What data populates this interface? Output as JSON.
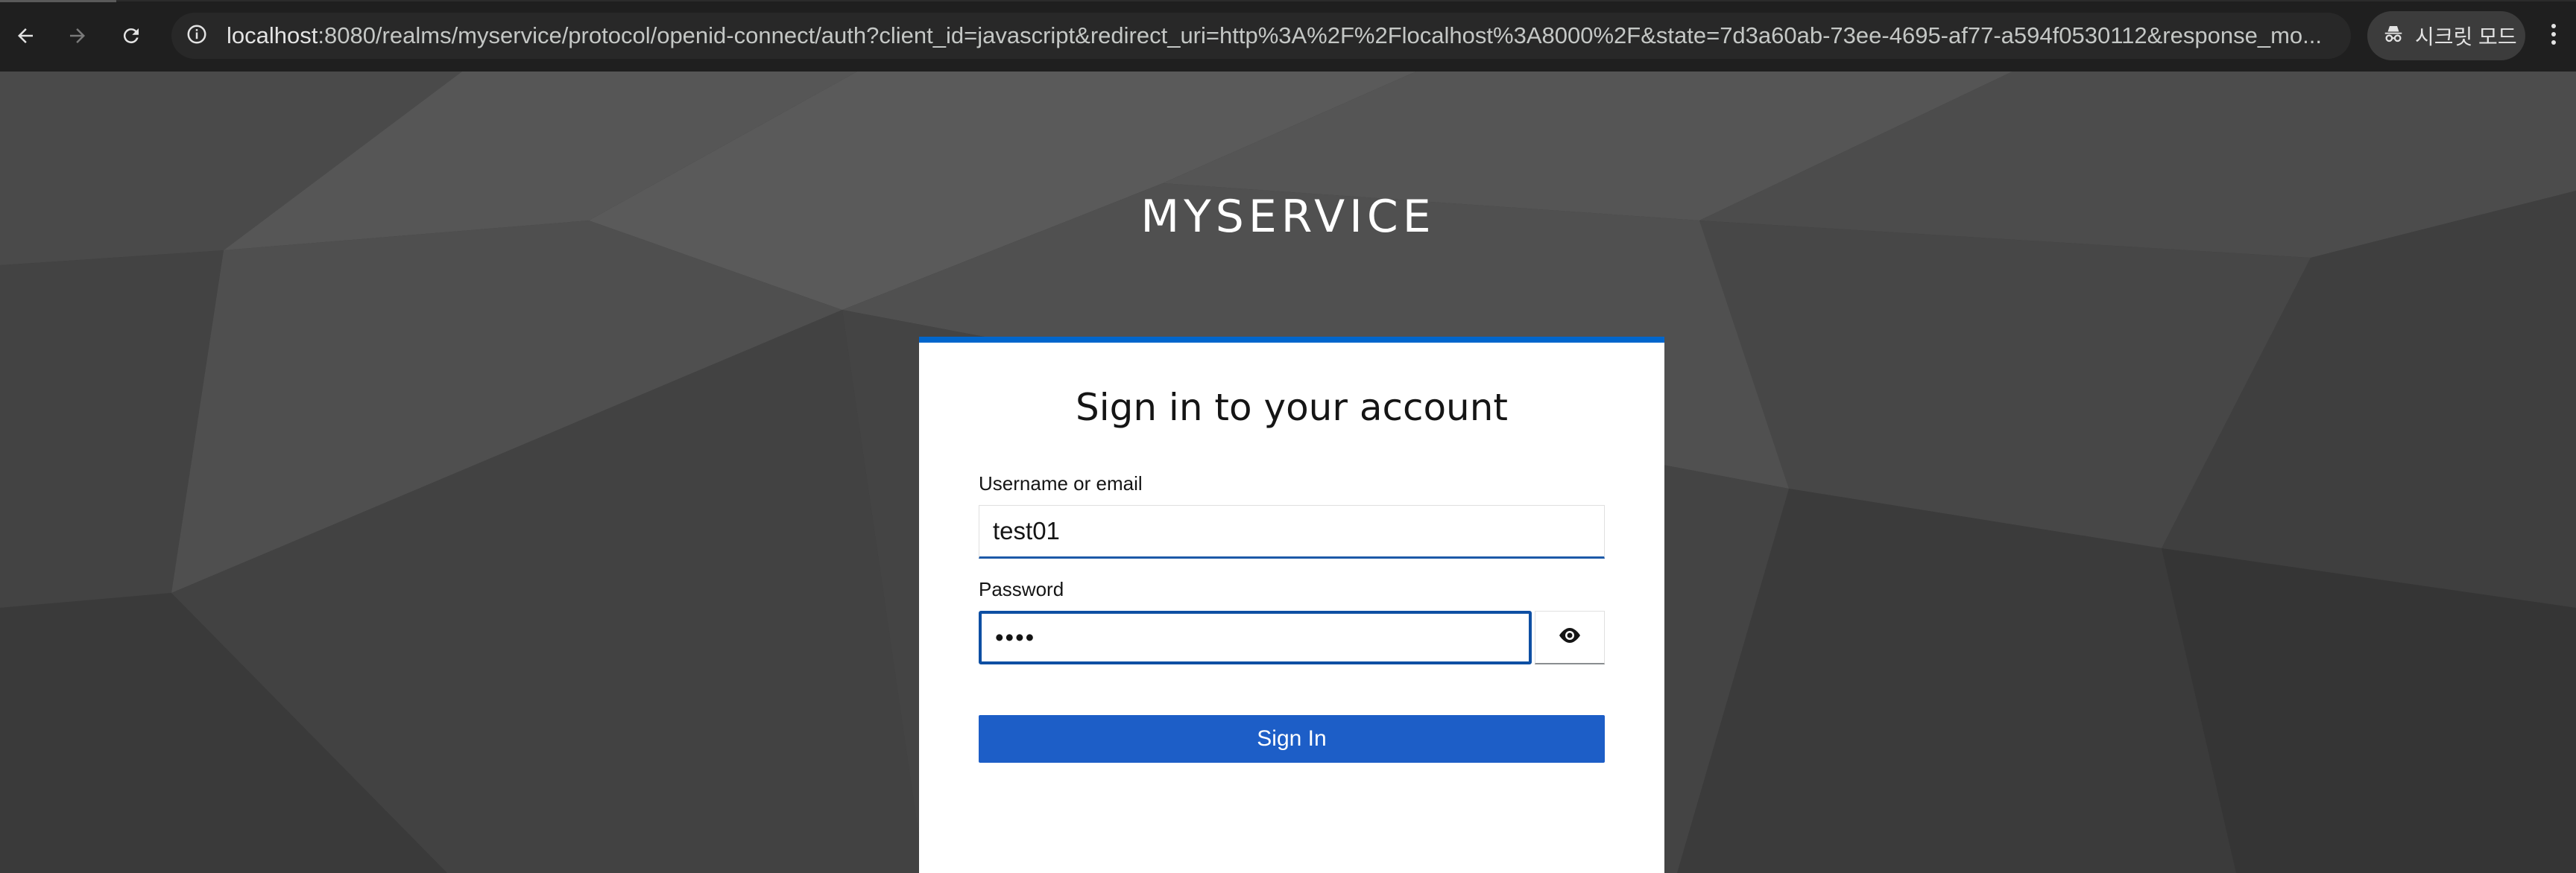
{
  "browser": {
    "url_host": "localhost",
    "url_rest": ":8080/realms/myservice/protocol/openid-connect/auth?client_id=javascript&redirect_uri=http%3A%2F%2Flocalhost%3A8000%2F&state=7d3a60ab-73ee-4695-af77-a594f0530112&response_mo...",
    "incognito_label": "시크릿 모드",
    "icons": {
      "back": "back-arrow-icon",
      "forward": "forward-arrow-icon",
      "reload": "reload-icon",
      "site_info": "info-icon",
      "bookmark": "star-icon",
      "incognito": "incognito-icon",
      "menu": "kebab-menu-icon"
    }
  },
  "page": {
    "realm_title": "MYSERVICE",
    "card": {
      "title": "Sign in to your account",
      "username_label": "Username or email",
      "username_value": "test01",
      "password_label": "Password",
      "password_value": "••••",
      "show_password_icon": "eye-icon",
      "submit_label": "Sign In"
    }
  },
  "colors": {
    "accent": "#0066cc",
    "button": "#1d5ec7",
    "background": "#3a3a3a",
    "chrome": "#1f1f1f"
  }
}
